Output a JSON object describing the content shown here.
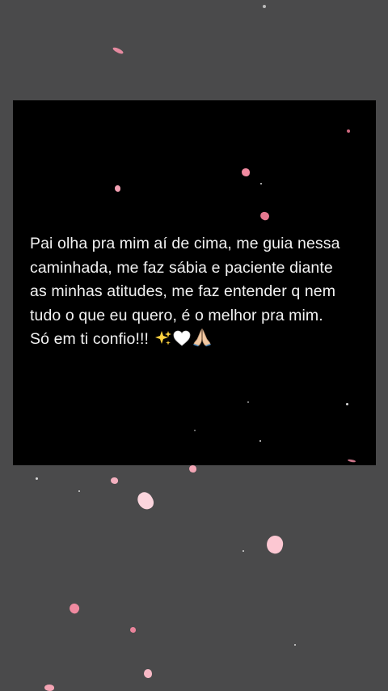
{
  "post": {
    "lines": [
      "Pai olha pra mim aí de cima, me guia nessa",
      "caminhada, me faz sábia e paciente diante",
      "as minhas atitudes, me faz entender q nem",
      "tudo o que eu quero, é o melhor pra mim.",
      "Só em ti confio!!!"
    ],
    "emojis": [
      "sparkles-emoji",
      "white-heart-emoji",
      "folded-hands-emoji"
    ]
  },
  "colors": {
    "background": "#4a4a4b",
    "card": "#000000",
    "text": "#f2f2f2",
    "petal": "#f4a6b4",
    "petal_dark": "#e07b8f"
  }
}
